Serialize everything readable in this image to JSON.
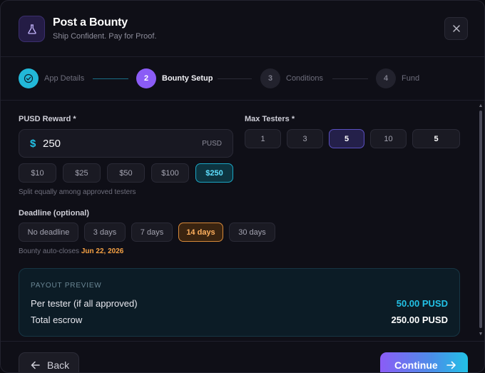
{
  "header": {
    "title": "Post a Bounty",
    "subtitle": "Ship Confident. Pay for Proof."
  },
  "stepper": {
    "steps": [
      {
        "number": "",
        "label": "App Details",
        "state": "done"
      },
      {
        "number": "2",
        "label": "Bounty Setup",
        "state": "active"
      },
      {
        "number": "3",
        "label": "Conditions",
        "state": "todo"
      },
      {
        "number": "4",
        "label": "Fund",
        "state": "todo"
      }
    ]
  },
  "reward": {
    "label": "PUSD Reward *",
    "currency_symbol": "$",
    "value": "250",
    "unit": "PUSD",
    "presets": [
      "$10",
      "$25",
      "$50",
      "$100",
      "$250"
    ],
    "selected": "$250",
    "hint": "Split equally among approved testers"
  },
  "testers": {
    "label": "Max Testers *",
    "options": [
      "1",
      "3",
      "5",
      "10",
      "5"
    ],
    "selected": "5"
  },
  "deadline": {
    "label": "Deadline (optional)",
    "options": [
      "No deadline",
      "3 days",
      "7 days",
      "14 days",
      "30 days"
    ],
    "selected": "14 days",
    "hint_prefix": "Bounty auto-closes",
    "close_date": "Jun 22, 2026"
  },
  "payout": {
    "title": "PAYOUT PREVIEW",
    "per_tester_label": "Per tester (if all approved)",
    "per_tester_value": "50.00 PUSD",
    "total_label": "Total escrow",
    "total_value": "250.00 PUSD"
  },
  "footer": {
    "back_label": "Back",
    "continue_label": "Continue"
  },
  "colors": {
    "accent_purple": "#8b5cf6",
    "accent_cyan": "#22c1e6",
    "accent_orange": "#f5a144"
  }
}
